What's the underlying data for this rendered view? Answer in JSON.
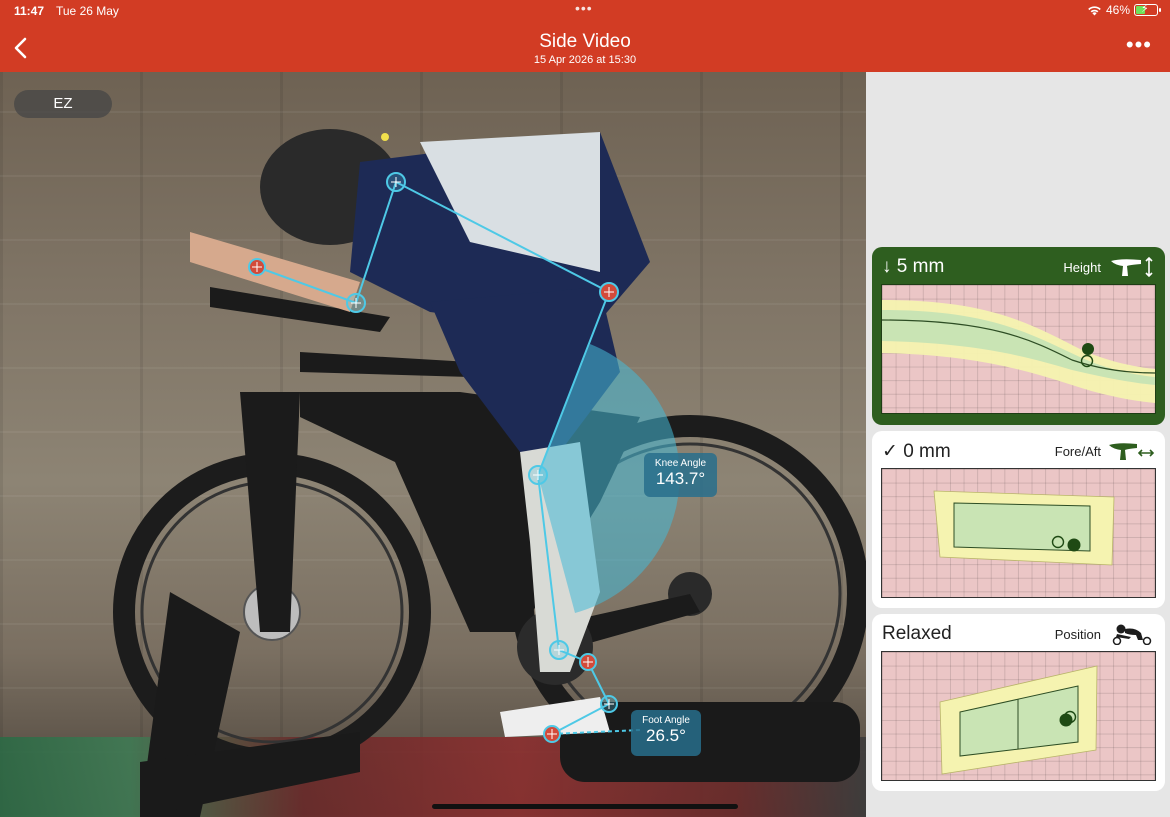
{
  "status_bar": {
    "time": "11:47",
    "date": "Tue 26 May",
    "battery": "46%",
    "battery_level": 0.46
  },
  "nav": {
    "title": "Side Video",
    "subtitle": "15 Apr 2026 at 15:30"
  },
  "video": {
    "badge": "EZ",
    "knee_angle": {
      "label": "Knee Angle",
      "value": "143.7°"
    },
    "foot_angle": {
      "label": "Foot Angle",
      "value": "26.5°"
    }
  },
  "panels": {
    "height": {
      "value": "↓ 5 mm",
      "label": "Height"
    },
    "fore_aft": {
      "value": "✓ 0 mm",
      "label": "Fore/Aft"
    },
    "position": {
      "value": "Relaxed",
      "label": "Position"
    }
  },
  "colors": {
    "nav_bar": "#d23c24",
    "overlay_line": "#4ec9e6",
    "panel_dark": "#2e5e1f",
    "zone_red": "#ebc6c6",
    "zone_yellow": "#f5f3b0",
    "zone_green": "#c9e4b4"
  },
  "icons": [
    "back-chevron-icon",
    "more-dots-icon",
    "wifi-icon",
    "battery-icon",
    "saddle-height-icon",
    "saddle-fore-aft-icon",
    "rider-position-icon"
  ]
}
